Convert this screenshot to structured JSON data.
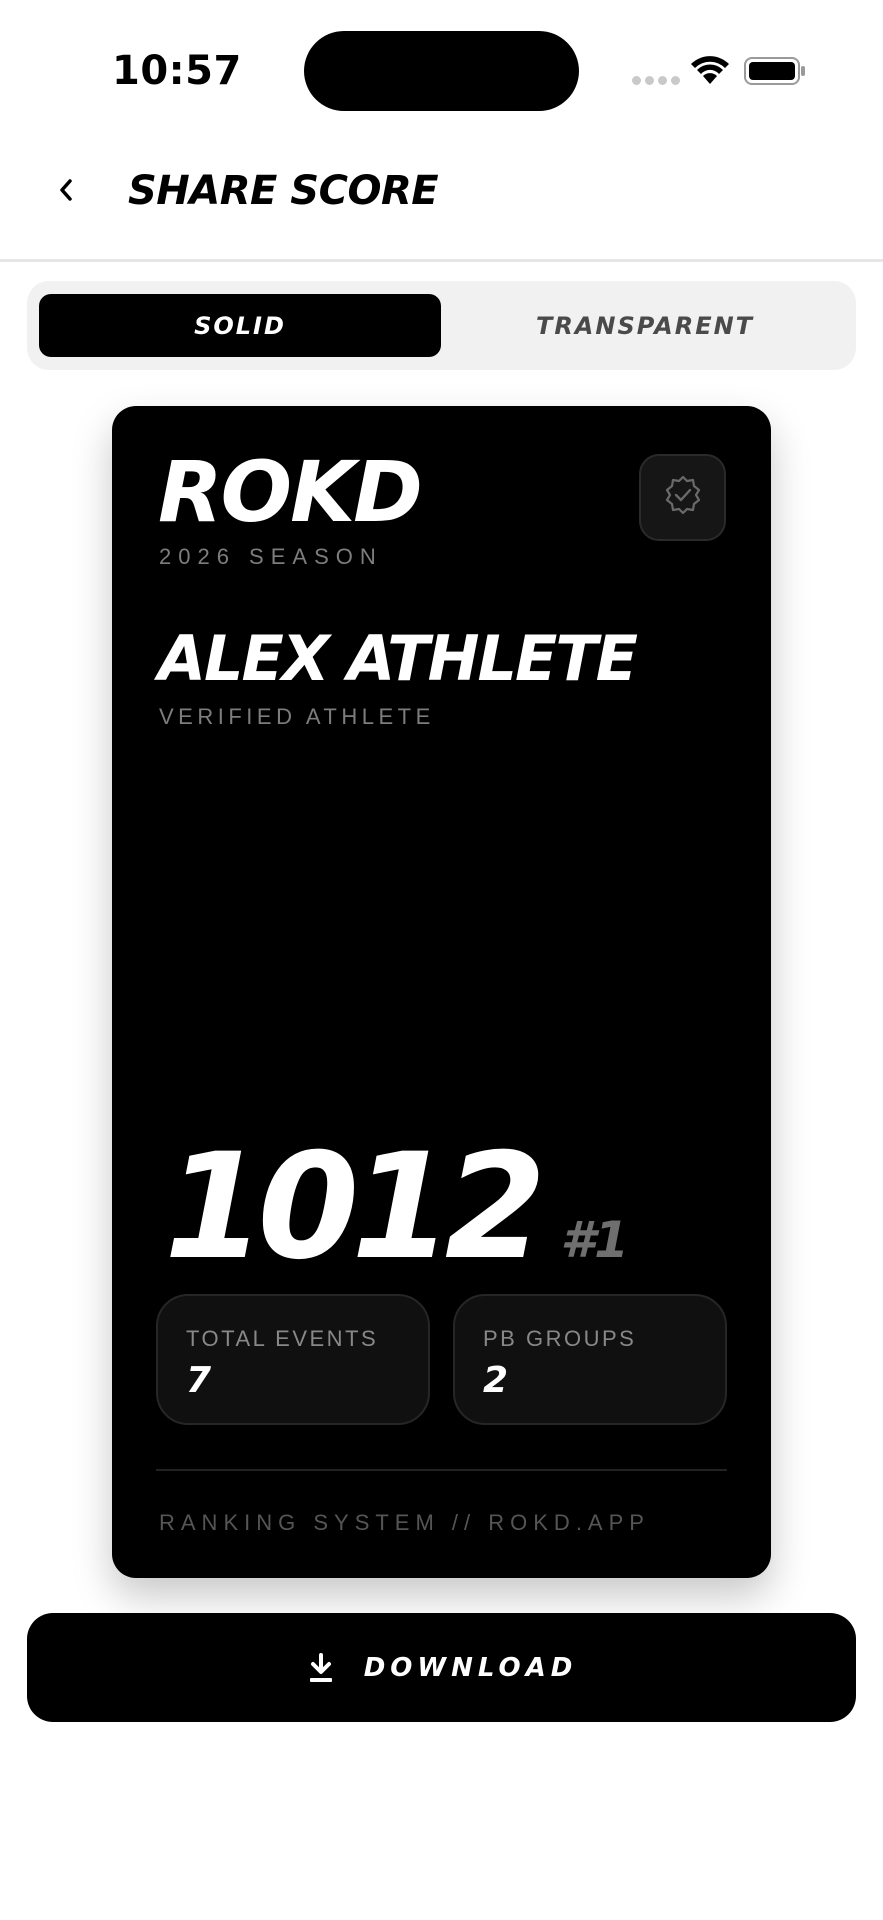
{
  "status_bar": {
    "time": "10:57",
    "icons": [
      "signal-dots-icon",
      "wifi-icon",
      "battery-icon"
    ]
  },
  "header": {
    "back_icon": "chevron-left-icon",
    "title": "SHARE SCORE"
  },
  "segment": {
    "options": [
      {
        "label": "SOLID",
        "selected": true
      },
      {
        "label": "TRANSPARENT",
        "selected": false
      }
    ]
  },
  "card": {
    "brand": "ROKD",
    "season": "2026 SEASON",
    "badge_icon": "verified-badge-icon",
    "athlete_name": "ALEX ATHLETE",
    "athlete_status": "VERIFIED ATHLETE",
    "score": "1012",
    "rank": "#1",
    "stats": [
      {
        "label": "TOTAL EVENTS",
        "value": "7"
      },
      {
        "label": "PB GROUPS",
        "value": "2"
      }
    ],
    "footer": "RANKING SYSTEM // ROKD.APP"
  },
  "download": {
    "label": "DOWNLOAD",
    "icon": "download-icon"
  },
  "colors": {
    "primary": "#000000",
    "background": "#ffffff",
    "muted_text": "#7d7d7d",
    "segment_bg": "#f1f1f1"
  }
}
